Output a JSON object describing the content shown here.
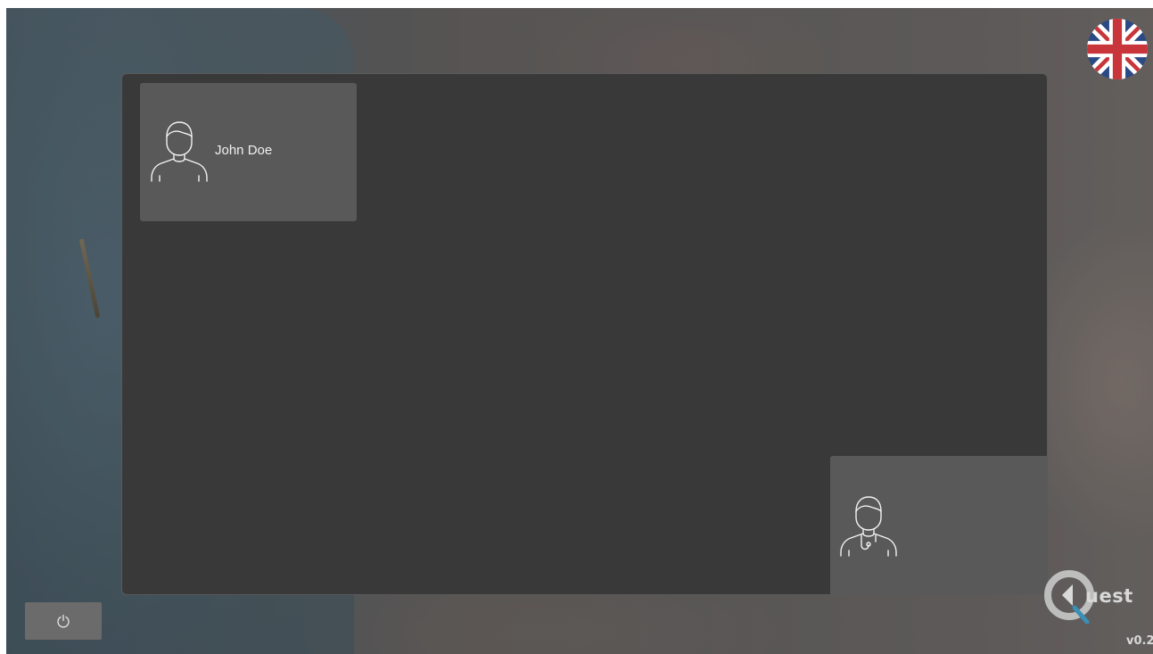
{
  "language": {
    "selected": "en-GB",
    "flag_icon": "uk-flag-icon"
  },
  "call": {
    "patient_tile": {
      "name": "John Doe",
      "icon": "patient-avatar-icon"
    },
    "doctor_tile": {
      "icon": "doctor-avatar-icon"
    }
  },
  "controls": {
    "power_icon": "power-icon"
  },
  "branding": {
    "logo_text": "uest",
    "version": "v0.2"
  },
  "colors": {
    "panel": "#393939",
    "tile": "#595959",
    "logo_accent": "#3a8fb7"
  }
}
